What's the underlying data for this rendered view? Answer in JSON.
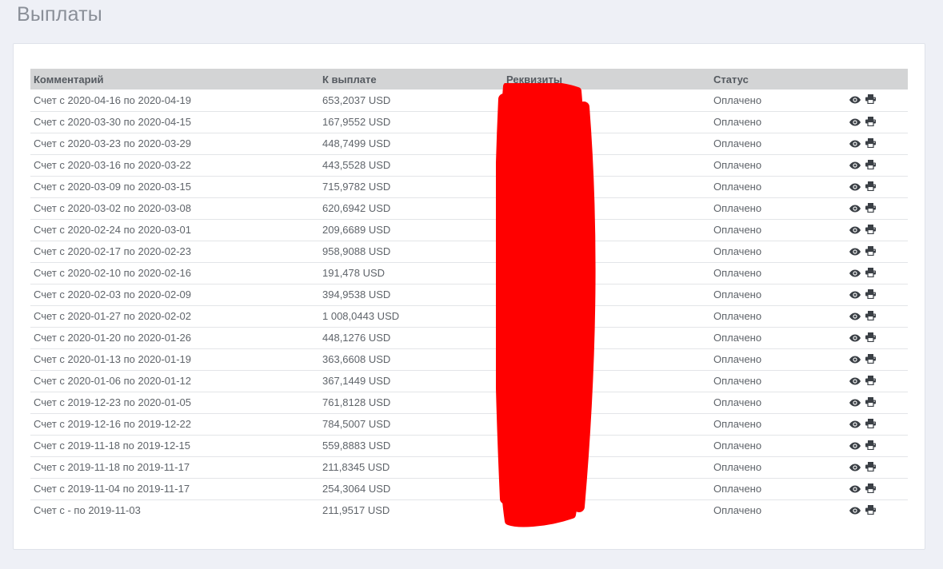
{
  "page": {
    "title": "Выплаты"
  },
  "table": {
    "headers": {
      "comment": "Комментарий",
      "amount": "К выплате",
      "details": "Реквизиты",
      "status": "Статус"
    },
    "rows": [
      {
        "comment": "Счет с 2020-04-16 по 2020-04-19",
        "amount": "653,2037 USD",
        "status": "Оплачено"
      },
      {
        "comment": "Счет с 2020-03-30 по 2020-04-15",
        "amount": "167,9552 USD",
        "status": "Оплачено"
      },
      {
        "comment": "Счет с 2020-03-23 по 2020-03-29",
        "amount": "448,7499 USD",
        "status": "Оплачено"
      },
      {
        "comment": "Счет с 2020-03-16 по 2020-03-22",
        "amount": "443,5528 USD",
        "status": "Оплачено"
      },
      {
        "comment": "Счет с 2020-03-09 по 2020-03-15",
        "amount": "715,9782 USD",
        "status": "Оплачено"
      },
      {
        "comment": "Счет с 2020-03-02 по 2020-03-08",
        "amount": "620,6942 USD",
        "status": "Оплачено"
      },
      {
        "comment": "Счет с 2020-02-24 по 2020-03-01",
        "amount": "209,6689 USD",
        "status": "Оплачено"
      },
      {
        "comment": "Счет с 2020-02-17 по 2020-02-23",
        "amount": "958,9088 USD",
        "status": "Оплачено"
      },
      {
        "comment": "Счет с 2020-02-10 по 2020-02-16",
        "amount": "191,478 USD",
        "status": "Оплачено"
      },
      {
        "comment": "Счет с 2020-02-03 по 2020-02-09",
        "amount": "394,9538 USD",
        "status": "Оплачено"
      },
      {
        "comment": "Счет с 2020-01-27 по 2020-02-02",
        "amount": "1 008,0443 USD",
        "status": "Оплачено"
      },
      {
        "comment": "Счет с 2020-01-20 по 2020-01-26",
        "amount": "448,1276 USD",
        "status": "Оплачено"
      },
      {
        "comment": "Счет с 2020-01-13 по 2020-01-19",
        "amount": "363,6608 USD",
        "status": "Оплачено"
      },
      {
        "comment": "Счет с 2020-01-06 по 2020-01-12",
        "amount": "367,1449 USD",
        "status": "Оплачено"
      },
      {
        "comment": "Счет с 2019-12-23 по 2020-01-05",
        "amount": "761,8128 USD",
        "status": "Оплачено"
      },
      {
        "comment": "Счет с 2019-12-16 по 2019-12-22",
        "amount": "784,5007 USD",
        "status": "Оплачено"
      },
      {
        "comment": "Счет с 2019-11-18 по 2019-12-15",
        "amount": "559,8883 USD",
        "status": "Оплачено"
      },
      {
        "comment": "Счет с 2019-11-18 по 2019-11-17",
        "amount": "211,8345 USD",
        "status": "Оплачено"
      },
      {
        "comment": "Счет с 2019-11-04 по 2019-11-17",
        "amount": "254,3064 USD",
        "status": "Оплачено"
      },
      {
        "comment": "Счет с - по 2019-11-03",
        "amount": "211,9517 USD",
        "status": "Оплачено"
      }
    ],
    "row_icons": [
      "eye-icon",
      "print-icon"
    ]
  },
  "colors": {
    "status_paid": "#5cb85c",
    "header_bg": "#d3d4d5",
    "page_bg": "#eef0f6",
    "redaction": "#ff0000"
  }
}
